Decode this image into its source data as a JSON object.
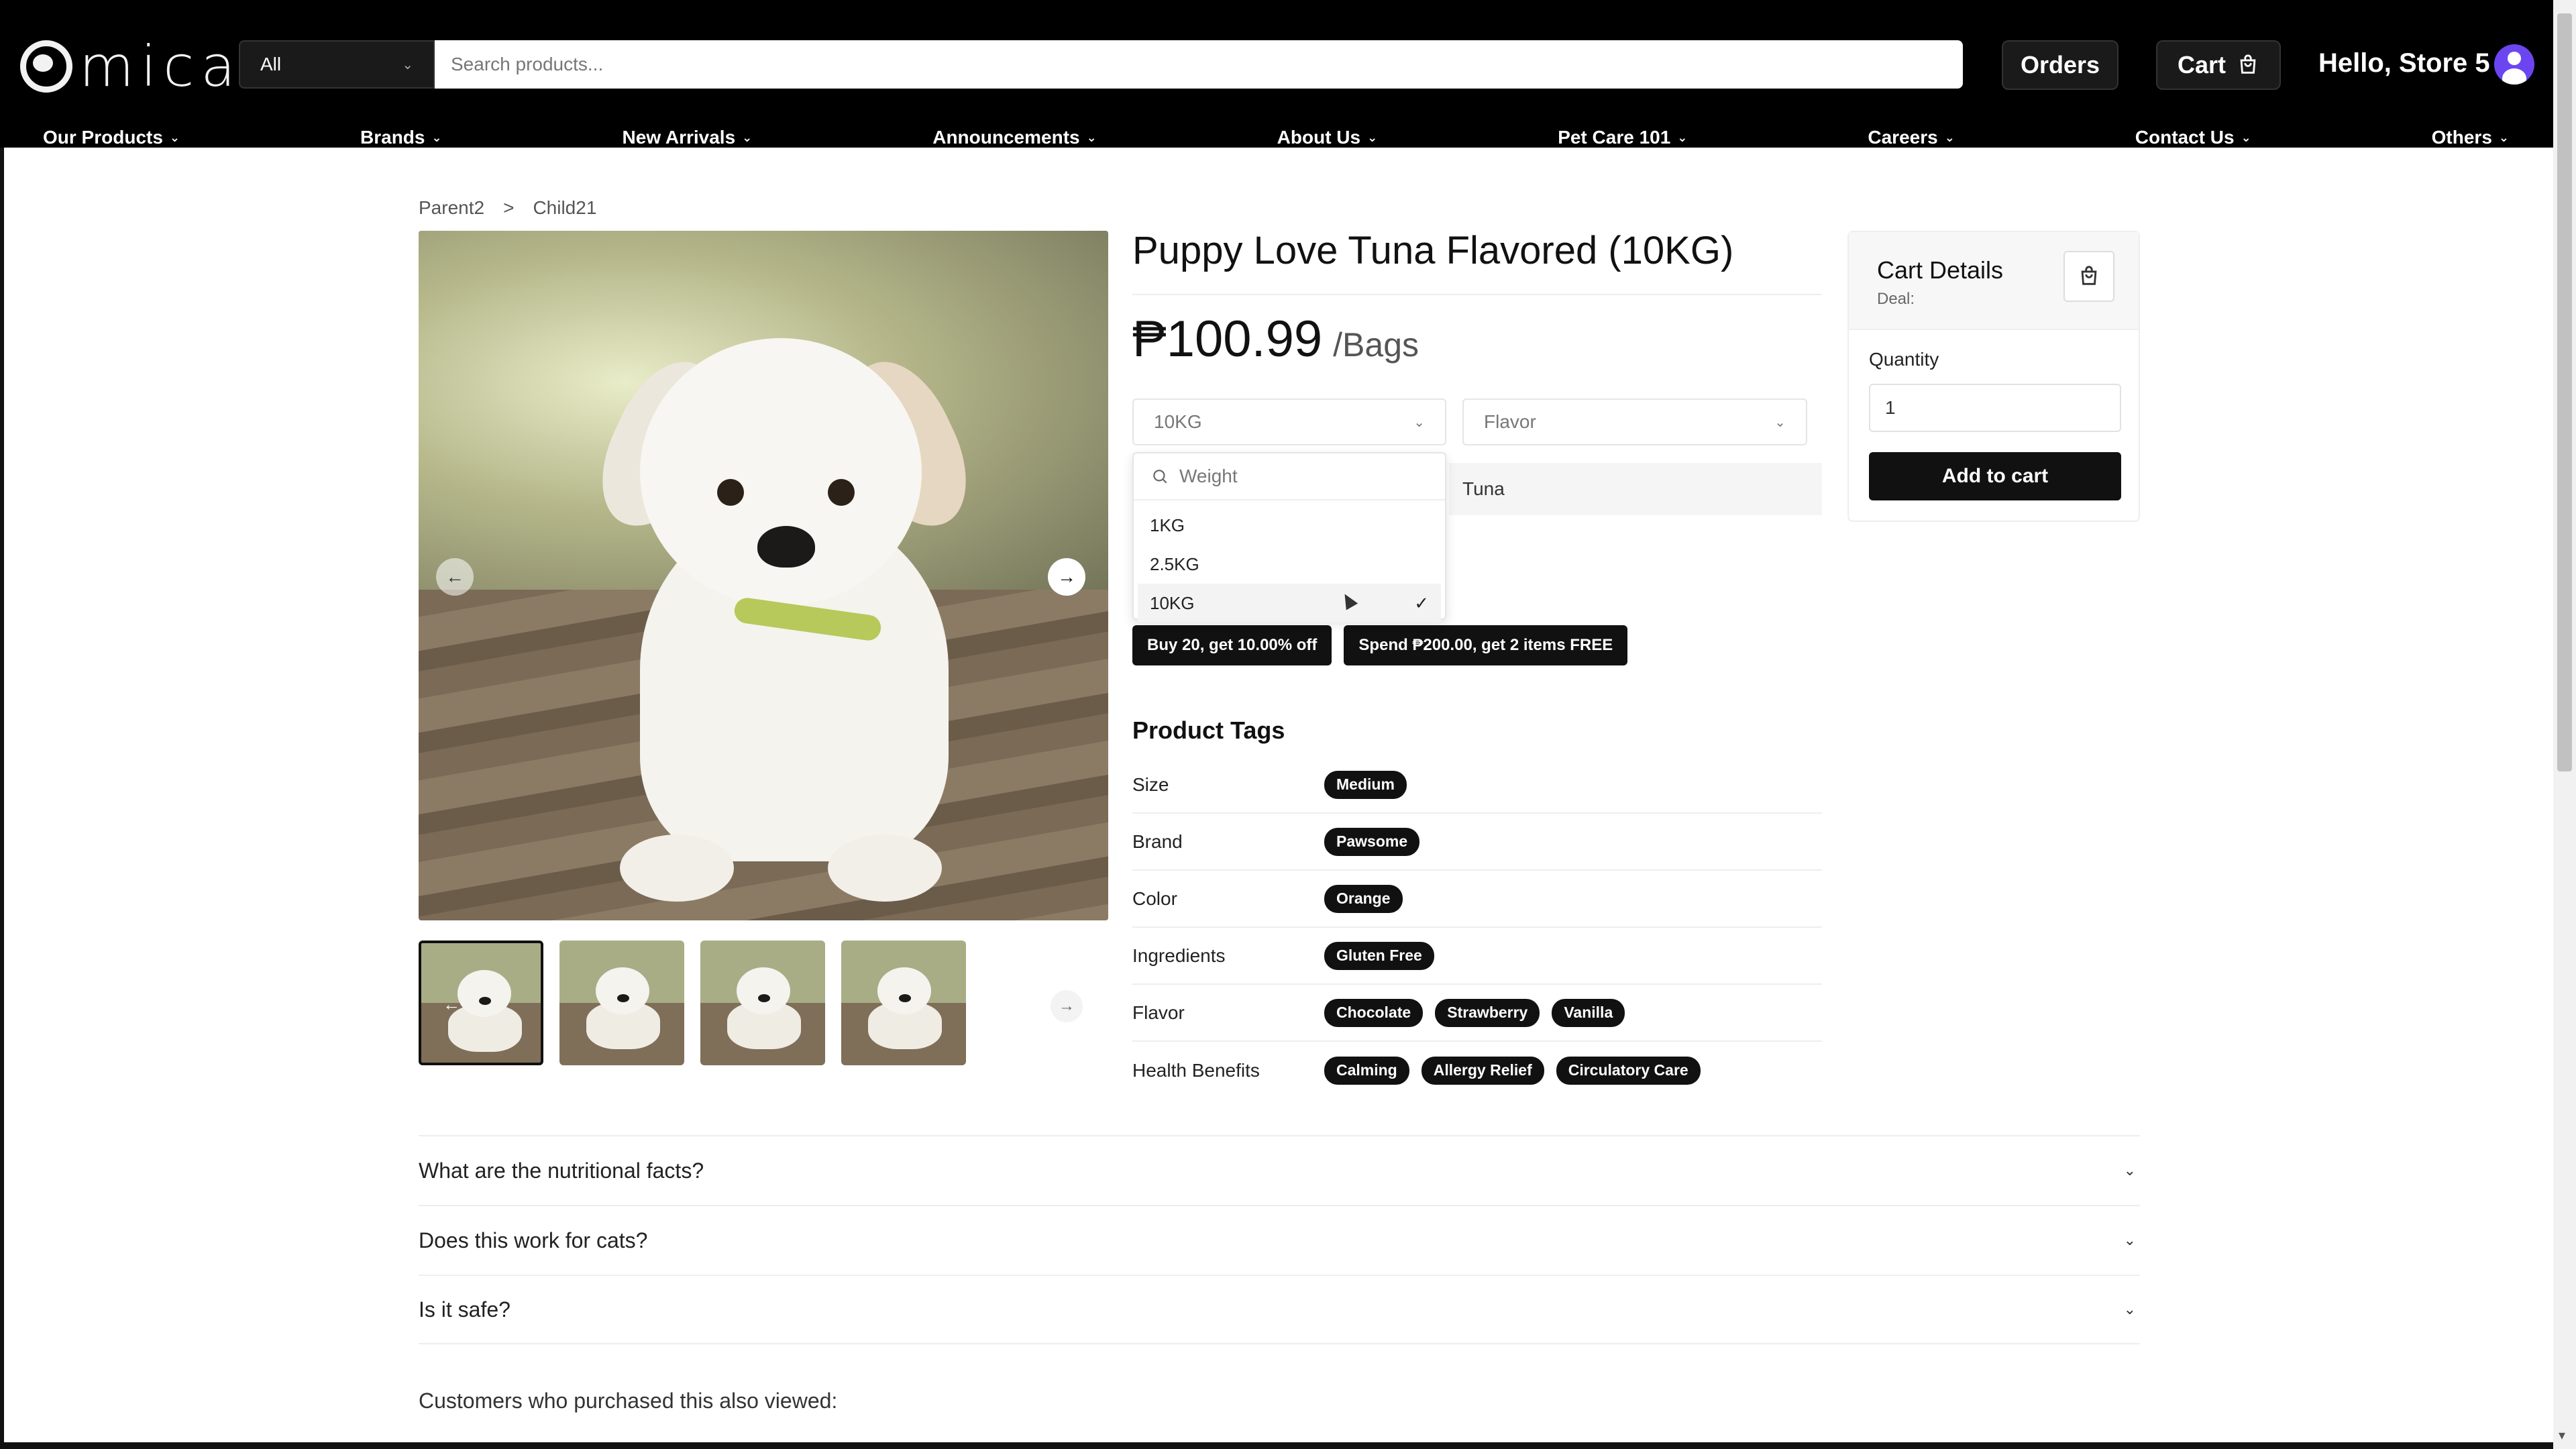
{
  "header": {
    "logo_text": "mica",
    "category_select": "All",
    "search_placeholder": "Search products...",
    "orders_label": "Orders",
    "cart_label": "Cart",
    "greeting": "Hello, Store 5"
  },
  "nav": {
    "items": [
      {
        "label": "Our Products"
      },
      {
        "label": "Brands"
      },
      {
        "label": "New Arrivals"
      },
      {
        "label": "Announcements"
      },
      {
        "label": "About Us"
      },
      {
        "label": "Pet Care 101"
      },
      {
        "label": "Careers"
      },
      {
        "label": "Contact Us"
      },
      {
        "label": "Others"
      }
    ]
  },
  "breadcrumb": {
    "parent": "Parent2",
    "separator": ">",
    "child": "Child21"
  },
  "product": {
    "title": "Puppy Love Tuna Flavored (10KG)",
    "price": "₱100.99",
    "unit": "/Bags",
    "weight_selected": "10KG",
    "flavor_placeholder": "Flavor",
    "flavor_value": "Tuna"
  },
  "weight_dropdown": {
    "search_placeholder": "Weight",
    "options": [
      {
        "label": "1KG"
      },
      {
        "label": "2.5KG"
      },
      {
        "label": "10KG",
        "check": "✓"
      }
    ]
  },
  "deals": [
    "Buy 20, get 10.00% off",
    "Spend ₱200.00, get 2 items FREE"
  ],
  "tags": {
    "title": "Product Tags",
    "rows": [
      {
        "name": "Size",
        "values": [
          "Medium"
        ]
      },
      {
        "name": "Brand",
        "values": [
          "Pawsome"
        ]
      },
      {
        "name": "Color",
        "values": [
          "Orange"
        ]
      },
      {
        "name": "Ingredients",
        "values": [
          "Gluten Free"
        ]
      },
      {
        "name": "Flavor",
        "values": [
          "Chocolate",
          "Strawberry",
          "Vanilla"
        ]
      },
      {
        "name": "Health Benefits",
        "values": [
          "Calming",
          "Allergy Relief",
          "Circulatory Care"
        ]
      }
    ]
  },
  "cart_panel": {
    "title": "Cart Details",
    "deal_label": "Deal:",
    "quantity_label": "Quantity",
    "quantity_value": "1",
    "add_button": "Add to cart"
  },
  "faq": [
    {
      "question": "What are the nutritional facts?"
    },
    {
      "question": "Does this work for cats?"
    },
    {
      "question": "Is it safe?"
    }
  ],
  "also_viewed": "Customers who purchased this also viewed:",
  "icons": {
    "chevron": "chevron-down-icon",
    "cart": "shopping-bag-icon",
    "search": "search-icon"
  }
}
